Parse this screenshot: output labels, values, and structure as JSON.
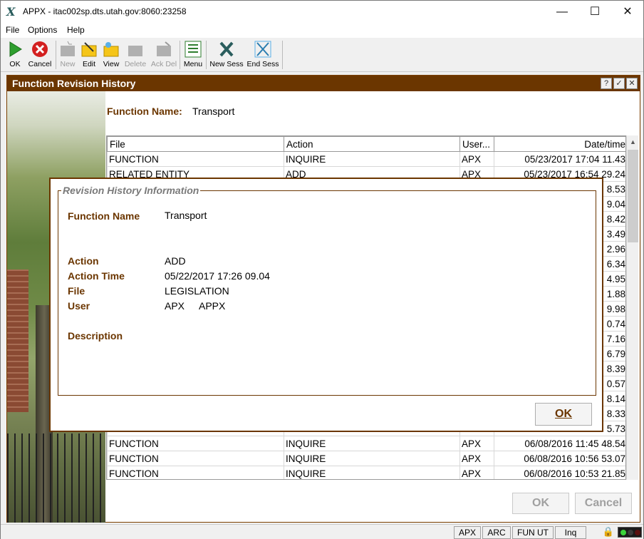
{
  "window": {
    "title": "APPX - itac002sp.dts.utah.gov:8060:23258",
    "minimize": "—",
    "maximize": "☐",
    "close": "✕"
  },
  "menubar": {
    "items": [
      "File",
      "Options",
      "Help"
    ]
  },
  "toolbar": {
    "ok": "OK",
    "cancel": "Cancel",
    "new": "New",
    "edit": "Edit",
    "view": "View",
    "delete": "Delete",
    "ack_del": "Ack Del",
    "menu": "Menu",
    "new_sess": "New Sess",
    "end_sess": "End Sess"
  },
  "frame": {
    "title": "Function Revision History",
    "help_btn": "?",
    "check_btn": "✓",
    "close_btn": "✕",
    "function_name_label": "Function Name:",
    "function_name_value": "Transport",
    "ok_label": "OK",
    "cancel_label": "Cancel"
  },
  "grid": {
    "headers": [
      "File",
      "Action",
      "User...",
      "Date/time"
    ],
    "rows": [
      [
        "FUNCTION",
        "INQUIRE",
        "APX",
        "05/23/2017 17:04 11.43"
      ],
      [
        "RELATED ENTITY",
        "ADD",
        "APX",
        "05/23/2017 16:54 29.24"
      ],
      [
        "",
        "",
        "",
        "8.53"
      ],
      [
        "",
        "",
        "",
        "9.04"
      ],
      [
        "",
        "",
        "",
        "8.42"
      ],
      [
        "",
        "",
        "",
        "3.49"
      ],
      [
        "",
        "",
        "",
        "2.96"
      ],
      [
        "",
        "",
        "",
        "6.34"
      ],
      [
        "",
        "",
        "",
        "4.95"
      ],
      [
        "",
        "",
        "",
        "1.88"
      ],
      [
        "",
        "",
        "",
        "9.98"
      ],
      [
        "",
        "",
        "",
        "0.74"
      ],
      [
        "",
        "",
        "",
        "7.16"
      ],
      [
        "",
        "",
        "",
        "6.79"
      ],
      [
        "",
        "",
        "",
        "8.39"
      ],
      [
        "",
        "",
        "",
        "0.57"
      ],
      [
        "",
        "",
        "",
        "8.14"
      ],
      [
        "",
        "",
        "",
        "8.33"
      ],
      [
        "",
        "",
        "",
        "5.73"
      ],
      [
        "FUNCTION",
        "INQUIRE",
        "APX",
        "06/08/2016 11:45 48.54"
      ],
      [
        "FUNCTION",
        "INQUIRE",
        "APX",
        "06/08/2016 10:56 53.07"
      ],
      [
        "FUNCTION",
        "INQUIRE",
        "APX",
        "06/08/2016 10:53 21.85"
      ]
    ]
  },
  "dialog": {
    "group_title": "Revision History Information",
    "function_name_label": "Function Name",
    "function_name_value": "Transport",
    "action_label": "Action",
    "action_value": "ADD",
    "action_time_label": "Action Time",
    "action_time_value": "05/22/2017 17:26 09.04",
    "file_label": "File",
    "file_value": "LEGISLATION",
    "user_label": "User",
    "user_value": "APX",
    "user_name_value": "APPX",
    "description_label": "Description",
    "ok_label": "OK"
  },
  "statusbar": {
    "apx": "APX",
    "arc": "ARC",
    "fun": "FUN UT",
    "inq": "Inq"
  },
  "colors": {
    "brand": "#6b3600",
    "ok_green": "#2e9e2e",
    "cancel_red": "#d32020"
  }
}
